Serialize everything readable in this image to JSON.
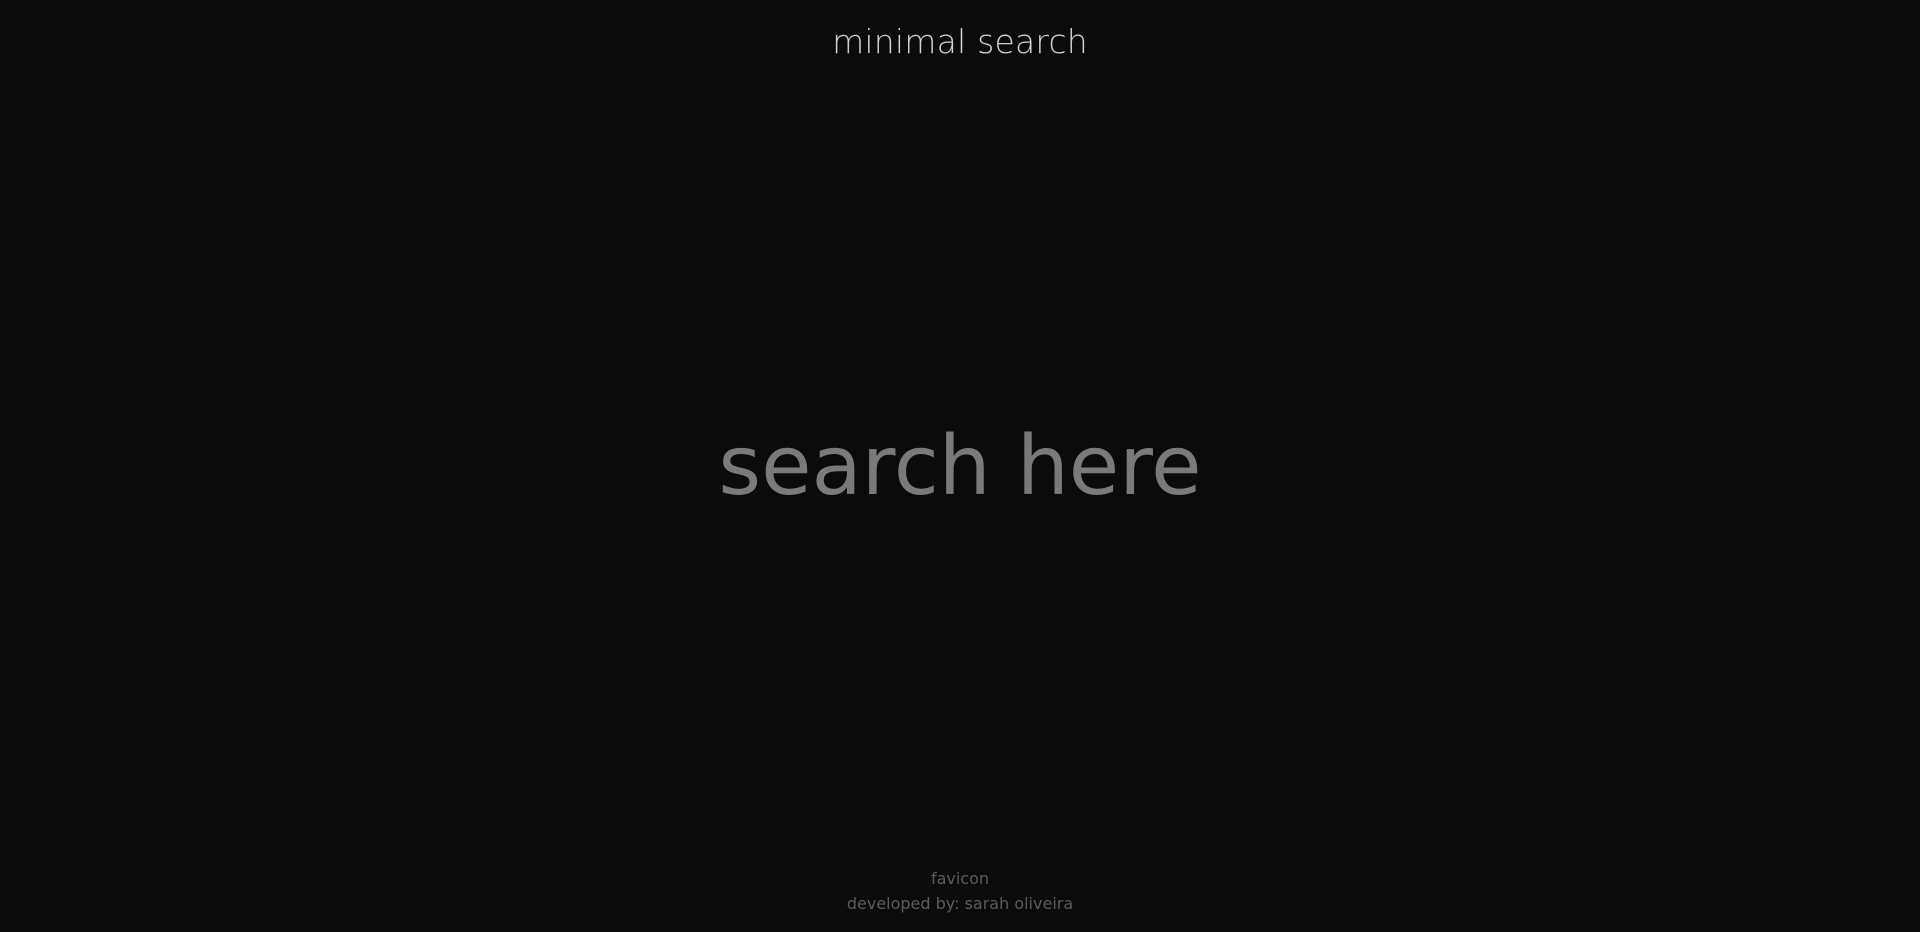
{
  "header": {
    "title": "minimal search"
  },
  "search": {
    "placeholder": "search here",
    "value": ""
  },
  "footer": {
    "credit_link": "favicon",
    "developer_text": "developed by: sarah oliveira"
  },
  "colors": {
    "background": "#0b0b0b",
    "title": "#d2d2d2",
    "placeholder": "#7a7a7a",
    "footer_text": "#5c5c5c"
  }
}
